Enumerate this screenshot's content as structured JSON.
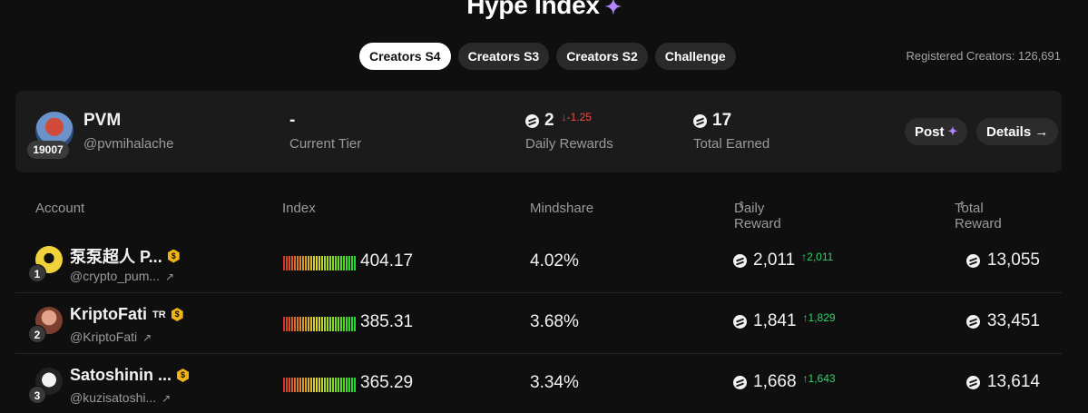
{
  "header": {
    "title": "Hype Index",
    "spark_icon": "sparkle-icon"
  },
  "tabs": [
    {
      "label": "Creators S4",
      "active": true
    },
    {
      "label": "Creators S3",
      "active": false
    },
    {
      "label": "Creators S2",
      "active": false
    },
    {
      "label": "Challenge",
      "active": false
    }
  ],
  "registered": "Registered Creators: 126,691",
  "me": {
    "rank": "19007",
    "name": "PVM",
    "handle": "@pvmihalache",
    "tier_value": "-",
    "tier_label": "Current Tier",
    "daily_value": "2",
    "daily_delta": "↓-1.25",
    "daily_label": "Daily Rewards",
    "total_value": "17",
    "total_label": "Total Earned",
    "post_label": "Post",
    "details_label": "Details →"
  },
  "table": {
    "headers": {
      "account": "Account",
      "index": "Index",
      "mindshare": "Mindshare",
      "daily": "Daily Reward",
      "total": "Total Reward",
      "sort_icon": "⌃⌄"
    },
    "rows": [
      {
        "rank": "1",
        "name": "泵泵超人 P...",
        "tag": "",
        "handle": "@crypto_pum...",
        "index": "404.17",
        "mindshare": "4.02%",
        "daily": "2,011",
        "daily_delta": "↑2,011",
        "total": "13,055"
      },
      {
        "rank": "2",
        "name": "KriptoFati",
        "tag": "TR",
        "handle": "@KriptoFati",
        "index": "385.31",
        "mindshare": "3.68%",
        "daily": "1,841",
        "daily_delta": "↑1,829",
        "total": "33,451"
      },
      {
        "rank": "3",
        "name": "Satoshinin ...",
        "tag": "",
        "handle": "@kuzisatoshi...",
        "index": "365.29",
        "mindshare": "3.34%",
        "daily": "1,668",
        "daily_delta": "↑1,643",
        "total": "13,614"
      }
    ]
  },
  "colors": {
    "background": "#0f0f0f",
    "card": "#1b1b1b",
    "accent_purple": "#b585ff",
    "up": "#2fd36a",
    "down": "#f04a4a",
    "verified": "#f0b419"
  },
  "icons": {
    "coin": "coin-icon",
    "verified": "verified-badge-icon",
    "external": "external-link-icon",
    "arrow": "arrow-right-icon"
  }
}
